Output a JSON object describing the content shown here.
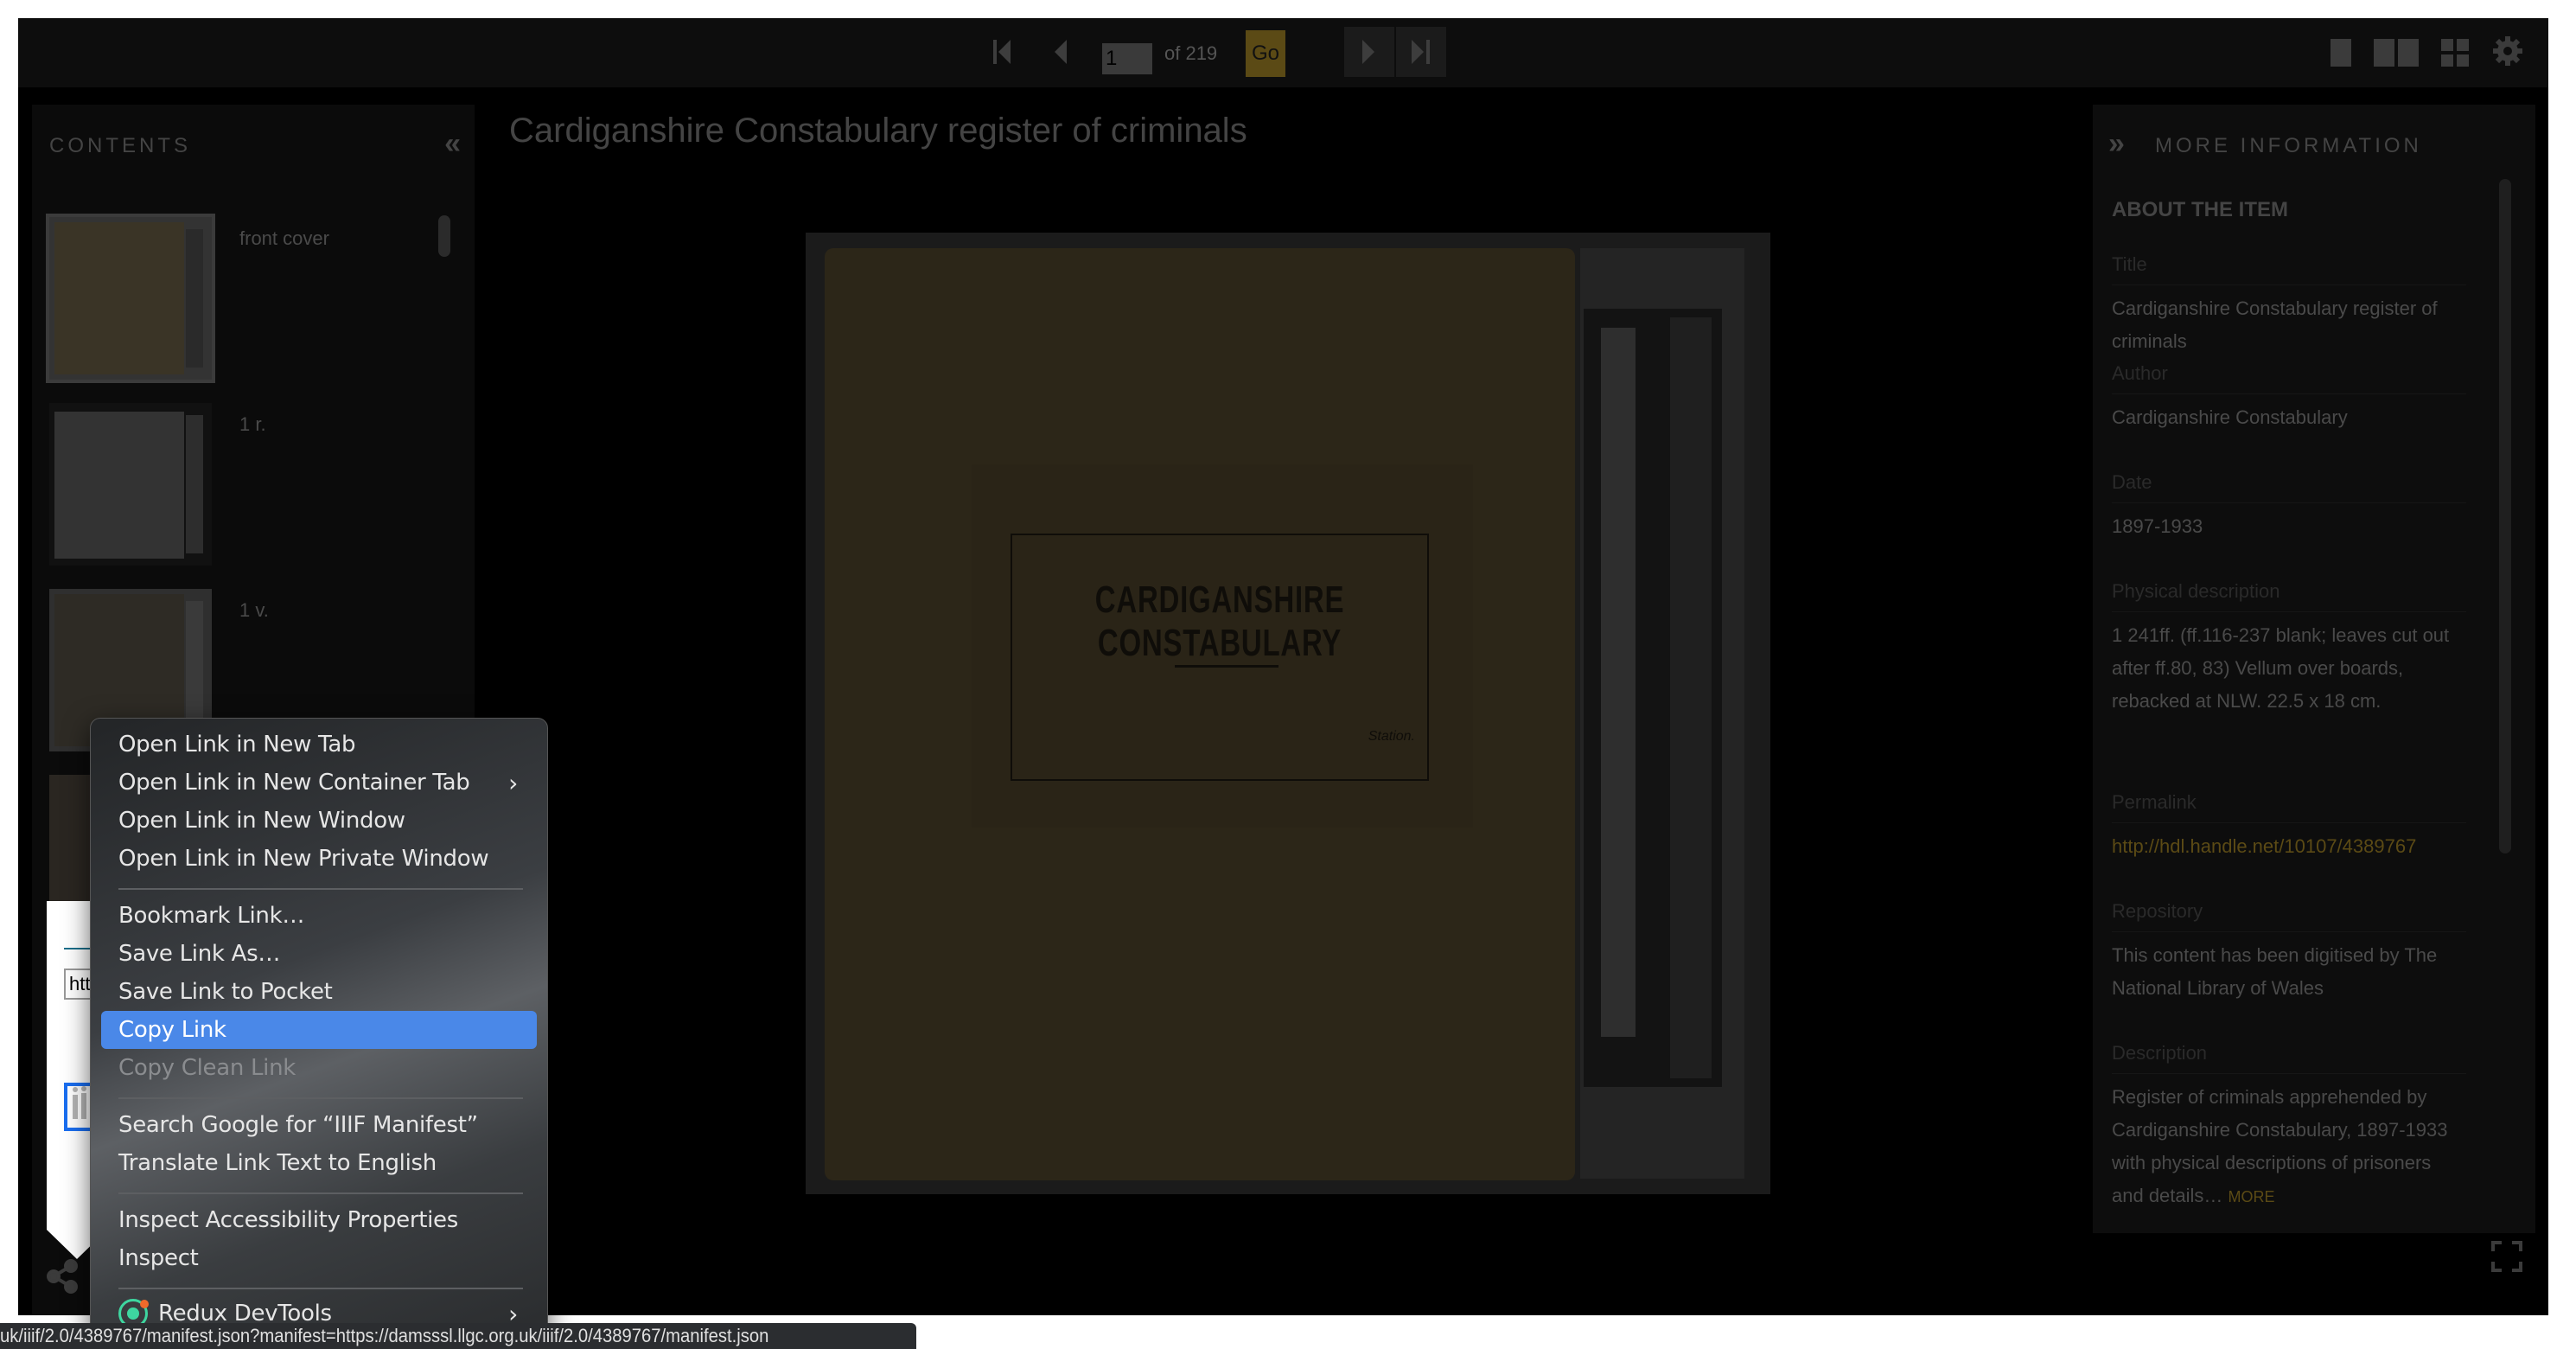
{
  "toolbar": {
    "first_page_icon": "first-page-icon",
    "prev_page_icon": "prev-page-icon",
    "page_input_value": "1",
    "page_of": "of 219",
    "go_label": "Go",
    "next_page_icon": "next-page-icon",
    "last_page_icon": "last-page-icon",
    "view_modes": [
      "one-up-icon",
      "two-up-icon",
      "gallery-icon"
    ],
    "settings_icon": "gear-icon"
  },
  "contents": {
    "title": "CONTENTS",
    "collapse_icon": "double-chevron-left-icon",
    "items": [
      {
        "label": "front cover",
        "selected": true
      },
      {
        "label": "1 r.",
        "selected": false
      },
      {
        "label": "1 v.",
        "selected": false
      },
      {
        "label": "",
        "selected": false
      }
    ]
  },
  "main": {
    "title": "Cardiganshire Constabulary register of criminals",
    "image_label_text": "CARDIGANSHIRE CONSTABULARY",
    "image_station_text": "Station."
  },
  "more_info": {
    "title": "MORE INFORMATION",
    "expand_icon": "double-chevron-right-icon",
    "section": "ABOUT THE ITEM",
    "fields": [
      {
        "label": "Title",
        "value": "Cardiganshire Constabulary register of criminals"
      },
      {
        "label": "Author",
        "value": "Cardiganshire Constabulary"
      },
      {
        "label": "Date",
        "value": "1897-1933"
      },
      {
        "label": "Physical description",
        "value": "1 241ff. (ff.116-237 blank; leaves cut out after ff.80, 83) Vellum over boards, rebacked at NLW. 22.5 x 18 cm."
      },
      {
        "label": "Permalink",
        "value": "http://hdl.handle.net/10107/4389767"
      },
      {
        "label": "Repository",
        "value": "This content has been digitised by The National Library of Wales"
      },
      {
        "label": "Description",
        "value": "Register of criminals apprehended by Cardiganshire Constabulary, 1897-1933 with physical descriptions of prisoners and details…"
      }
    ],
    "more_label": "MORE",
    "fullscreen_icon": "fullscreen-icon"
  },
  "share_popup": {
    "url_value": "htt",
    "iiif_icon": "iiif-logo-icon",
    "share_icon": "share-icon"
  },
  "context_menu": {
    "items": [
      {
        "label": "Open Link in New Tab"
      },
      {
        "label": "Open Link in New Container Tab",
        "submenu": true
      },
      {
        "label": "Open Link in New Window"
      },
      {
        "label": "Open Link in New Private Window"
      },
      {
        "label": "Bookmark Link…"
      },
      {
        "label": "Save Link As…"
      },
      {
        "label": "Save Link to Pocket"
      },
      {
        "label": "Copy Link",
        "highlighted": true
      },
      {
        "label": "Copy Clean Link",
        "disabled": true
      },
      {
        "label": "Search Google for “IIIF Manifest”"
      },
      {
        "label": "Translate Link Text to English"
      },
      {
        "label": "Inspect Accessibility Properties"
      },
      {
        "label": "Inspect"
      },
      {
        "label": "Redux DevTools",
        "submenu": true
      }
    ],
    "submenu_arrow": "›"
  },
  "statusbar": {
    "text": "uk/iiif/2.0/4389767/manifest.json?manifest=https://damsssl.llgc.org.uk/iiif/2.0/4389767/manifest.json"
  },
  "colors": {
    "accent_gold": "#5b4a15",
    "menu_highlight": "#4a88e8"
  }
}
